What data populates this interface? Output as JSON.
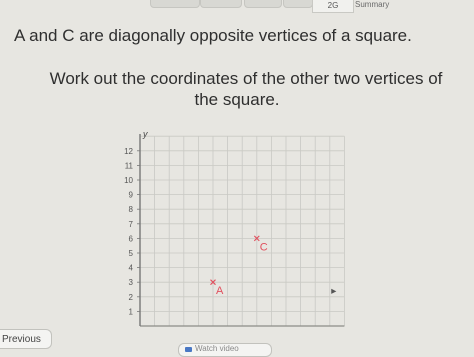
{
  "tabs": {
    "current_label": "2G",
    "summary_label": "Summary"
  },
  "question": {
    "line1": "A and C are diagonally opposite vertices of a square.",
    "line2a": "Work out the coordinates of the other two vertices of",
    "line2b": "the square."
  },
  "grid": {
    "y_axis_label": "y",
    "y_ticks": [
      "1",
      "2",
      "3",
      "4",
      "5",
      "6",
      "7",
      "8",
      "9",
      "10",
      "11",
      "12"
    ],
    "points": [
      {
        "label": "A",
        "x": 5,
        "y": 3
      },
      {
        "label": "C",
        "x": 8,
        "y": 6
      }
    ],
    "point_color": "#e0505e"
  },
  "nav": {
    "previous_label": "Previous",
    "watch_label": "Watch video"
  }
}
